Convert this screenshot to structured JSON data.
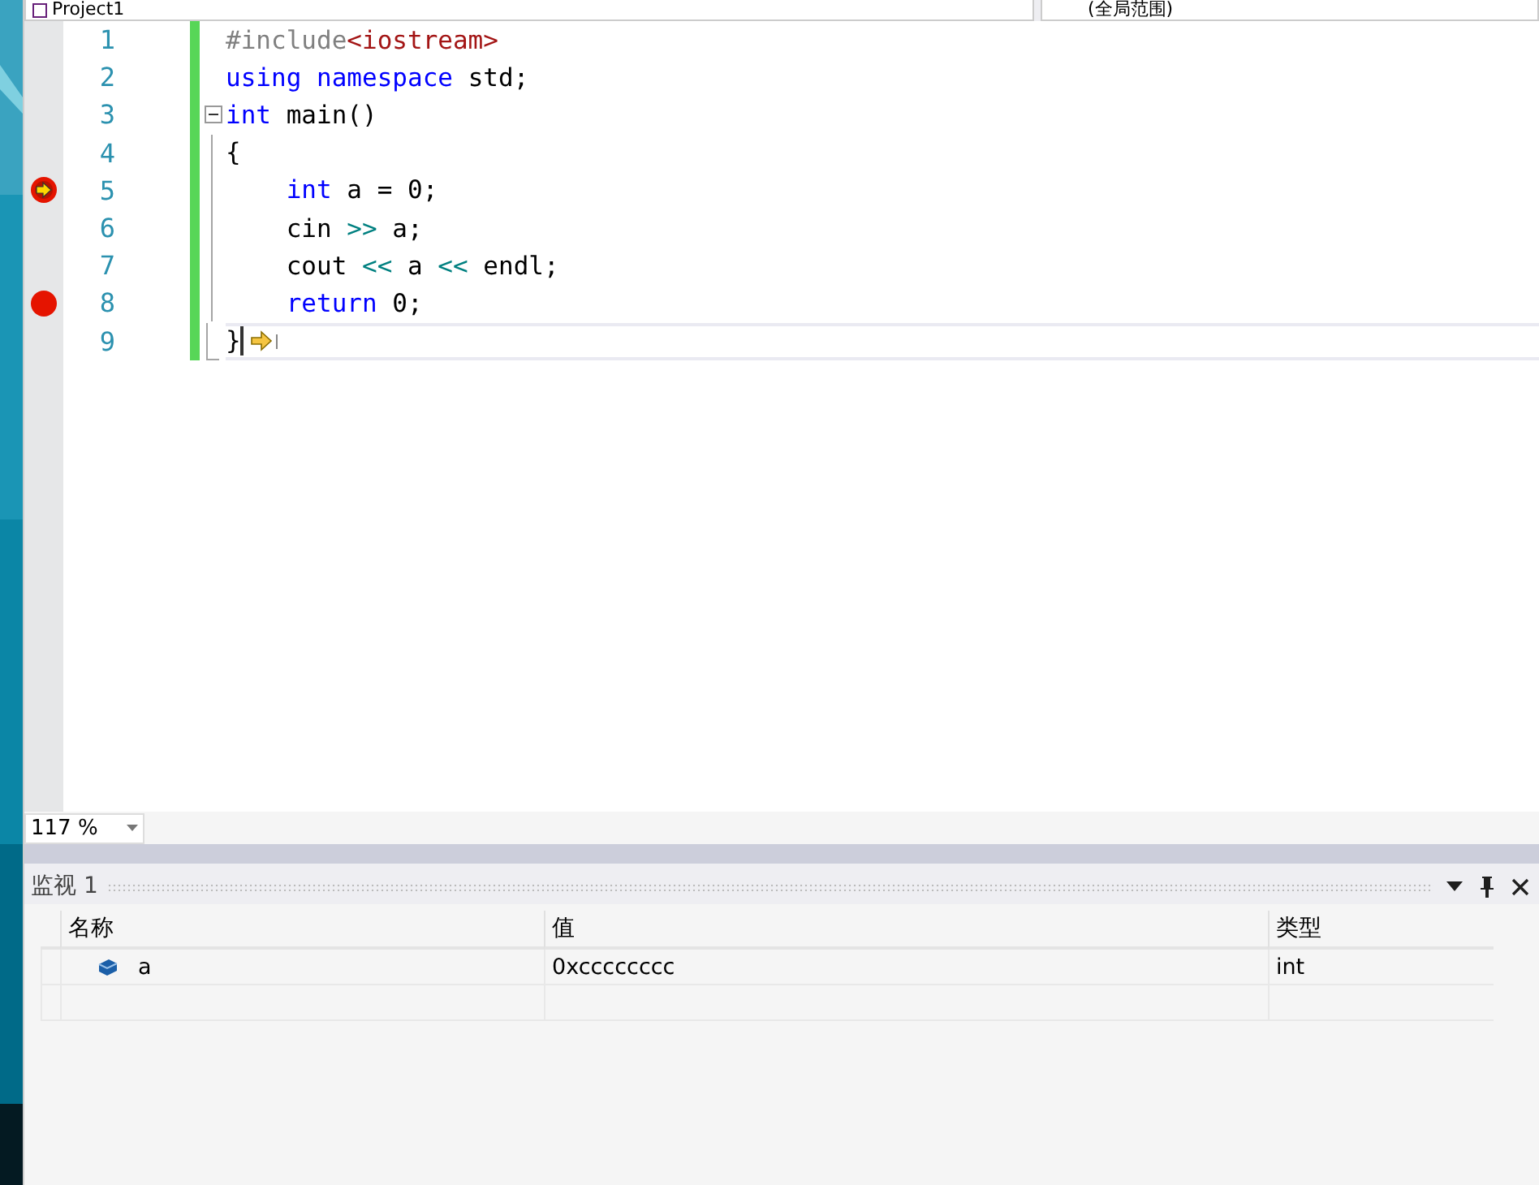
{
  "navbar": {
    "project": "Project1",
    "scope": "(全局范围)"
  },
  "editor": {
    "lines": [
      {
        "number": "1",
        "breakpoint": false,
        "current": false,
        "caret": false,
        "tokens": [
          {
            "kind": "preproc",
            "text": "#include"
          },
          {
            "kind": "string",
            "text": "<iostream>"
          }
        ]
      },
      {
        "number": "2",
        "breakpoint": false,
        "current": false,
        "caret": false,
        "tokens": [
          {
            "kind": "keyword",
            "text": "using"
          },
          {
            "kind": "keyword",
            "text": " namespace"
          },
          {
            "kind": "plain",
            "text": " std;"
          }
        ]
      },
      {
        "number": "3",
        "breakpoint": false,
        "current": false,
        "caret": false,
        "expanded": true,
        "tokens": [
          {
            "kind": "keyword",
            "text": "int"
          },
          {
            "kind": "plain",
            "text": " main()"
          }
        ]
      },
      {
        "number": "4",
        "breakpoint": false,
        "current": false,
        "caret": false,
        "tokens": [
          {
            "kind": "plain",
            "text": "{"
          }
        ]
      },
      {
        "number": "5",
        "breakpoint": true,
        "current": true,
        "caret": false,
        "tokens": [
          {
            "kind": "keyword",
            "text": "    int"
          },
          {
            "kind": "plain",
            "text": " a = 0;"
          }
        ]
      },
      {
        "number": "6",
        "breakpoint": false,
        "current": false,
        "caret": false,
        "tokens": [
          {
            "kind": "plain",
            "text": "    cin "
          },
          {
            "kind": "operator",
            "text": ">>"
          },
          {
            "kind": "plain",
            "text": " a;"
          }
        ]
      },
      {
        "number": "7",
        "breakpoint": false,
        "current": false,
        "caret": false,
        "tokens": [
          {
            "kind": "plain",
            "text": "    cout "
          },
          {
            "kind": "operator",
            "text": "<<"
          },
          {
            "kind": "plain",
            "text": " a "
          },
          {
            "kind": "operator",
            "text": "<<"
          },
          {
            "kind": "plain",
            "text": " endl;"
          }
        ]
      },
      {
        "number": "8",
        "breakpoint": true,
        "current": false,
        "caret": false,
        "tokens": [
          {
            "kind": "keyword",
            "text": "    return"
          },
          {
            "kind": "plain",
            "text": " 0;"
          }
        ]
      },
      {
        "number": "9",
        "breakpoint": false,
        "current": false,
        "caret": true,
        "tokens": [
          {
            "kind": "plain",
            "text": "}"
          }
        ]
      }
    ],
    "zoom": "117 %"
  },
  "watch": {
    "title": "监视 1",
    "columns": [
      "名称",
      "值",
      "类型"
    ],
    "rows": [
      {
        "name": "a",
        "value": "0xcccccccc",
        "type": "int"
      }
    ]
  }
}
